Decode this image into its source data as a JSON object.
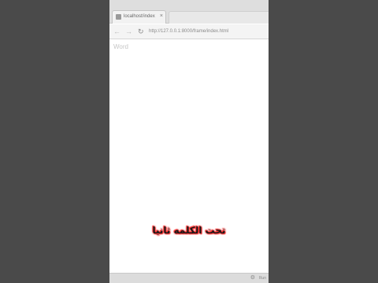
{
  "browser": {
    "tab": {
      "title": "localhost/index",
      "close": "×"
    },
    "toolbar": {
      "back": "←",
      "forward": "→",
      "reload": "↻",
      "url": "http://127.0.0.1:8000/frame/index.html"
    }
  },
  "page": {
    "text": "Word"
  },
  "caption": {
    "text": "تحت الكلمه ثانيا"
  },
  "status": {
    "icon": "⚙",
    "text": "Run"
  }
}
